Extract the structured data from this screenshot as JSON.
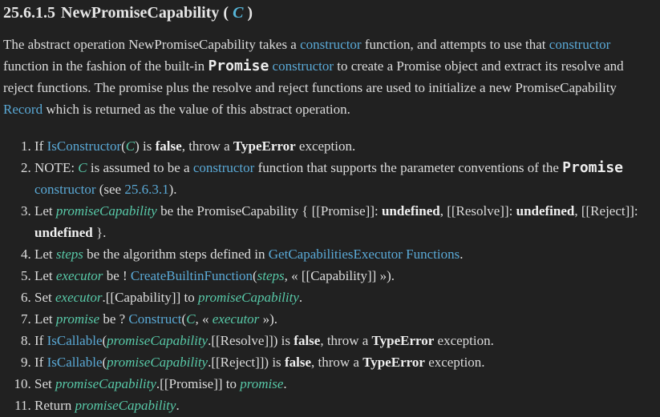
{
  "heading": {
    "number": "25.6.1.5",
    "title": "NewPromiseCapability",
    "open_paren": "(",
    "param": "C",
    "close_paren": ")"
  },
  "intro": {
    "t1": "The abstract operation NewPromiseCapability takes a ",
    "link_constructor_1": "constructor",
    "t2": " function, and attempts to use that ",
    "link_constructor_2": "constructor",
    "t3": " function in the fashion of the built-in ",
    "code_promise": "Promise",
    "t4": " ",
    "link_constructor_3": "constructor",
    "t5": " to create a Promise object and extract its resolve and reject functions. The promise plus the resolve and reject functions are used to initialize a new PromiseCapability ",
    "link_record": "Record",
    "t6": " which is returned as the value of this abstract operation."
  },
  "steps": {
    "s1": {
      "a": "If ",
      "link": "IsConstructor",
      "b": "(",
      "var": "C",
      "c": ") is ",
      "bold1": "false",
      "d": ", throw a ",
      "bold2": "TypeError",
      "e": " exception."
    },
    "s2": {
      "a": "NOTE: ",
      "var": "C",
      "b": " is assumed to be a ",
      "link": "constructor",
      "c": " function that supports the parameter conventions of the ",
      "code": "Promise",
      "d": " ",
      "link2": "constructor",
      "e": " (see ",
      "link3": "25.6.3.1",
      "f": ")."
    },
    "s3": {
      "a": "Let ",
      "var": "promiseCapability",
      "b": " be the PromiseCapability { [[Promise]]: ",
      "bold1": "undefined",
      "c": ", [[Resolve]]: ",
      "bold2": "undefined",
      "d": ", [[Reject]]: ",
      "bold3": "undefined",
      "e": " }."
    },
    "s4": {
      "a": "Let ",
      "var": "steps",
      "b": " be the algorithm steps defined in ",
      "link": "GetCapabilitiesExecutor Functions",
      "c": "."
    },
    "s5": {
      "a": "Let ",
      "var": "executor",
      "b": " be ! ",
      "link": "CreateBuiltinFunction",
      "c": "(",
      "var2": "steps",
      "d": ", « [[Capability]] »)."
    },
    "s6": {
      "a": "Set ",
      "var": "executor",
      "b": ".[[Capability]] to ",
      "var2": "promiseCapability",
      "c": "."
    },
    "s7": {
      "a": "Let ",
      "var": "promise",
      "b": " be ? ",
      "link": "Construct",
      "c": "(",
      "var2": "C",
      "d": ", « ",
      "var3": "executor",
      "e": " »)."
    },
    "s8": {
      "a": "If ",
      "link": "IsCallable",
      "b": "(",
      "var": "promiseCapability",
      "c": ".[[Resolve]]) is ",
      "bold1": "false",
      "d": ", throw a ",
      "bold2": "TypeError",
      "e": " exception."
    },
    "s9": {
      "a": "If ",
      "link": "IsCallable",
      "b": "(",
      "var": "promiseCapability",
      "c": ".[[Reject]]) is ",
      "bold1": "false",
      "d": ", throw a ",
      "bold2": "TypeError",
      "e": " exception."
    },
    "s10": {
      "a": "Set ",
      "var": "promiseCapability",
      "b": ".[[Promise]] to ",
      "var2": "promise",
      "c": "."
    },
    "s11": {
      "a": "Return ",
      "var": "promiseCapability",
      "b": "."
    }
  }
}
